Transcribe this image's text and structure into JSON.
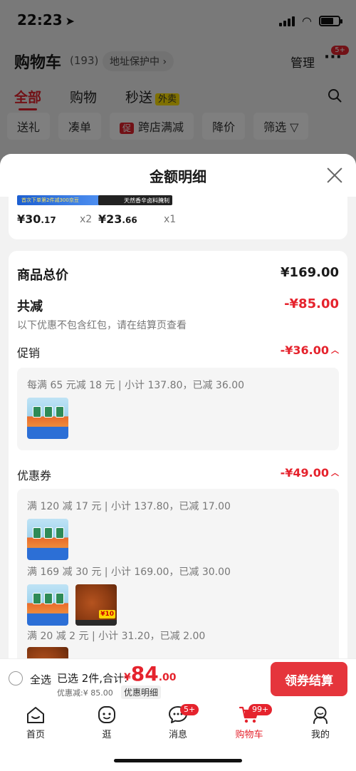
{
  "status": {
    "time": "22:23"
  },
  "cart": {
    "title": "购物车",
    "count": "(193)",
    "address": "地址保护中 ›",
    "manage": "管理",
    "more_badge": "5+"
  },
  "tabs": [
    {
      "label": "全部",
      "active": true
    },
    {
      "label": "购物"
    },
    {
      "label": "秒送"
    }
  ],
  "waimai": "外卖",
  "chips": [
    "送礼",
    "凑单",
    "跨店满减",
    "降价",
    "筛选 ▽"
  ],
  "chip_promo": "促",
  "sheet": {
    "title": "金额明细",
    "goods": [
      {
        "price_int": "¥30",
        "price_dec": ".17",
        "qty": "x2"
      },
      {
        "price_int": "¥23",
        "price_dec": ".66",
        "qty": "x1"
      }
    ],
    "strip_a_text": "首次下单第2件减300京豆",
    "strip_b_text": "天然香辛卤料腌制",
    "total_label": "商品总价",
    "total_value": "¥169.00",
    "reduce_label": "共减",
    "reduce_value": "-¥85.00",
    "note": "以下优惠不包含红包，请在结算页查看",
    "promo_label": "促销",
    "promo_value": "-¥36.00",
    "promo_rule": "每满 65 元减 18 元 | 小计 137.80，已减 36.00",
    "coupon_label": "优惠券",
    "coupon_value": "-¥49.00",
    "coupon_rules": [
      "满 120 减 17 元 | 小计 137.80，已减 17.00",
      "满 169 减 30 元 | 小计 169.00，已减 30.00",
      "满 20 减 2 元 | 小计 31.20，已减 2.00"
    ],
    "img_tag": "¥10"
  },
  "checkout": {
    "select_all": "全选",
    "selected": "已选 2件,合计:",
    "yen": "¥",
    "total_int": "84",
    "total_dec": ".00",
    "discount": "优惠减:¥ 85.00",
    "detail_link": "优惠明细",
    "button": "领券结算"
  },
  "tabbar": [
    {
      "label": "首页",
      "icon": "home-icon"
    },
    {
      "label": "逛",
      "icon": "face-icon"
    },
    {
      "label": "消息",
      "icon": "message-icon",
      "badge": "5+"
    },
    {
      "label": "购物车",
      "icon": "cart-icon",
      "badge": "99+",
      "active": true
    },
    {
      "label": "我的",
      "icon": "profile-icon"
    }
  ],
  "colors": {
    "accent": "#e5232d",
    "button": "#e5353c"
  }
}
